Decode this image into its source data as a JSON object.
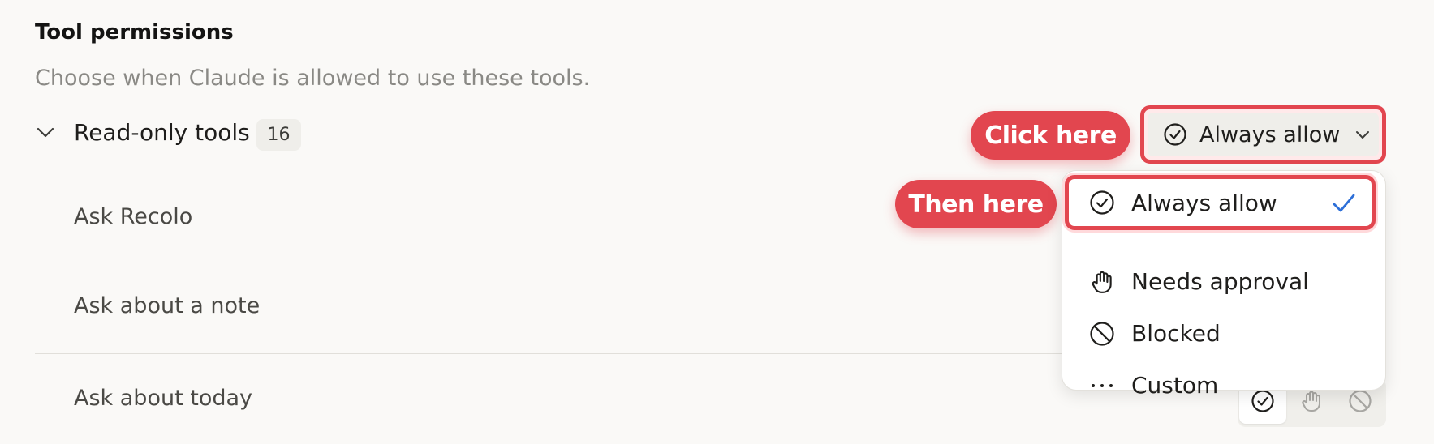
{
  "header": {
    "title": "Tool permissions",
    "subtitle": "Choose when Claude is allowed to use these tools."
  },
  "group": {
    "label": "Read-only tools",
    "count": "16",
    "expanded": true,
    "chevron_icon": "chevron-down-icon"
  },
  "tools": [
    {
      "label": "Ask Recolo"
    },
    {
      "label": "Ask about a note"
    },
    {
      "label": "Ask about today"
    }
  ],
  "permission_dropdown": {
    "selected_label": "Always allow",
    "selected_icon": "check-circle-icon",
    "chevron_icon": "chevron-down-icon"
  },
  "permission_menu": {
    "items": [
      {
        "label": "Always allow",
        "icon": "check-circle-icon",
        "selected": true
      },
      {
        "label": "Needs approval",
        "icon": "hand-icon",
        "selected": false
      },
      {
        "label": "Blocked",
        "icon": "blocked-icon",
        "selected": false
      },
      {
        "label": "Custom",
        "icon": "more-horizontal-icon",
        "selected": false
      }
    ]
  },
  "annotations": {
    "first": "Click here",
    "second": "Then here"
  },
  "row_segment_icons": [
    "check-circle-icon",
    "hand-icon",
    "blocked-icon"
  ],
  "colors": {
    "annotation_red": "#e2464f",
    "check_blue": "#2d6fd8",
    "background": "#faf9f7"
  }
}
